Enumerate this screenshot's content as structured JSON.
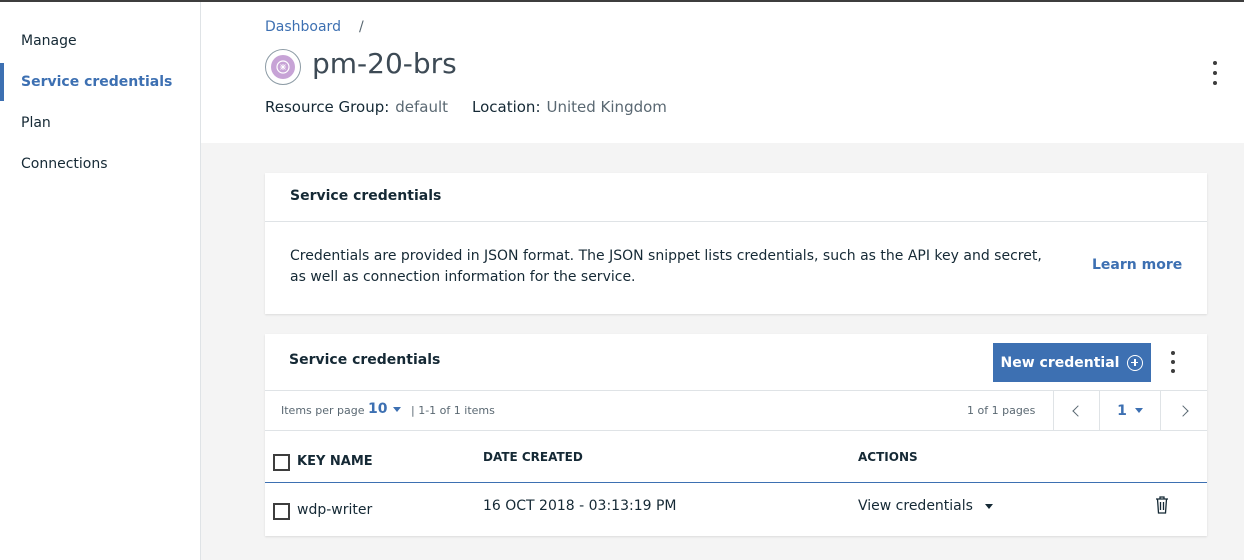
{
  "sidebar": {
    "items": [
      {
        "label": "Manage"
      },
      {
        "label": "Service credentials"
      },
      {
        "label": "Plan"
      },
      {
        "label": "Connections"
      }
    ]
  },
  "header": {
    "breadcrumb": {
      "link": "Dashboard",
      "separator": "/"
    },
    "title": "pm-20-brs",
    "resource_group_label": "Resource Group:",
    "resource_group_value": "default",
    "location_label": "Location:",
    "location_value": "United Kingdom"
  },
  "info_card": {
    "title": "Service credentials",
    "description": "Credentials are provided in JSON format. The JSON snippet lists credentials, such as the API key and secret, as well as connection information for the service.",
    "learn_more": "Learn more"
  },
  "credentials_card": {
    "title": "Service credentials",
    "new_button": "New credential",
    "pagination": {
      "items_per_page_label": "Items per page",
      "items_per_page": "10",
      "range": "| 1-1 of 1 items",
      "pages": "1 of 1 pages",
      "current_page": "1"
    },
    "columns": [
      "KEY NAME",
      "DATE CREATED",
      "ACTIONS"
    ],
    "rows": [
      {
        "key_name": "wdp-writer",
        "date_created": "16 OCT 2018 - 03:13:19 PM",
        "action": "View credentials"
      }
    ]
  },
  "colors": {
    "accent": "#3d70b2",
    "text": "#152935",
    "background": "#f4f4f4"
  },
  "icons": [
    "service-icon",
    "overflow-menu-icon",
    "add-circle-icon",
    "chevron-down-icon",
    "chevron-left-icon",
    "chevron-right-icon",
    "trash-icon"
  ]
}
